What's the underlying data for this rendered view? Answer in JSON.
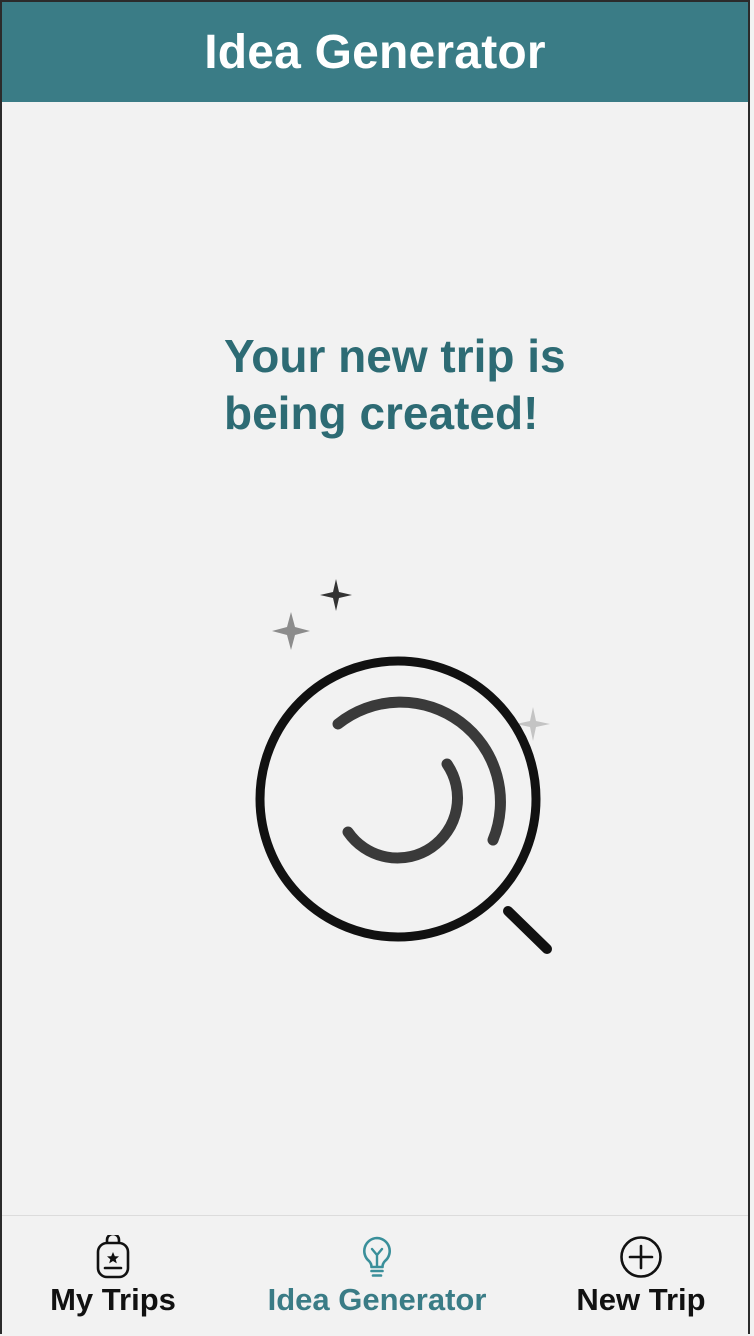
{
  "header": {
    "title": "Idea Generator"
  },
  "main": {
    "message": "Your new trip is being created!",
    "illustration_icon": "magnifier-loading-icon"
  },
  "bottom_nav": {
    "items": [
      {
        "label": "My Trips",
        "icon": "backpack-icon",
        "active": false
      },
      {
        "label": "Idea Generator",
        "icon": "lightbulb-icon",
        "active": true
      },
      {
        "label": "New Trip",
        "icon": "plus-circle-icon",
        "active": false
      }
    ]
  },
  "colors": {
    "header_bg": "#3a7c86",
    "accent": "#3a7c86",
    "message_text": "#2d6b74",
    "background": "#f2f2f2"
  }
}
